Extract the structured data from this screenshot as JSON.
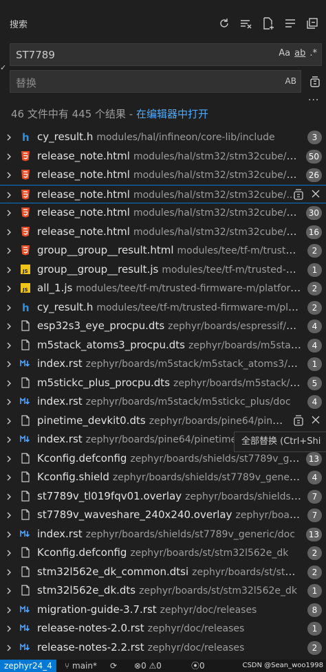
{
  "header": {
    "title": "搜索",
    "icons": [
      "refresh-icon",
      "clear-results-icon",
      "new-search-editor-icon",
      "view-as-tree-icon",
      "collapse-all-icon"
    ]
  },
  "search": {
    "value": "ST7789",
    "options": [
      "Aa",
      "ab",
      ".*"
    ]
  },
  "replace": {
    "placeholder": "替换",
    "preserve_case": "AB"
  },
  "summary": {
    "text": "46 文件中有 445 个结果 - ",
    "link": "在编辑器中打开"
  },
  "tooltip": "全部替换 (Ctrl+Shi",
  "results": [
    {
      "name": "cy_result.h",
      "path": "modules/hal/infineon/core-lib/include",
      "count": "3",
      "icon": "h"
    },
    {
      "name": "release_note.html",
      "path": "modules/hal/stm32/stm32cube/stm3...",
      "count": "50",
      "icon": "html"
    },
    {
      "name": "release_note.html",
      "path": "modules/hal/stm32/stm32cube/stm3...",
      "count": "26",
      "icon": "html"
    },
    {
      "name": "release_note.html",
      "path": "modules/hal/stm32/stm32cube/...",
      "count": "",
      "icon": "html",
      "selected": true
    },
    {
      "name": "release_note.html",
      "path": "modules/hal/stm32/stm32cube/stm3...",
      "count": "30",
      "icon": "html"
    },
    {
      "name": "release_note.html",
      "path": "modules/hal/stm32/stm32cube/stm3...",
      "count": "16",
      "icon": "html"
    },
    {
      "name": "group__group__result.html",
      "path": "modules/tee/tf-m/trusted-fi...",
      "count": "2",
      "icon": "html"
    },
    {
      "name": "group__group__result.js",
      "path": "modules/tee/tf-m/trusted-firm...",
      "count": "1",
      "icon": "js"
    },
    {
      "name": "all_1.js",
      "path": "modules/tee/tf-m/trusted-firmware-m/platform/e...",
      "count": "2",
      "icon": "js"
    },
    {
      "name": "cy_result.h",
      "path": "modules/tee/tf-m/trusted-firmware-m/platfor...",
      "count": "2",
      "icon": "h"
    },
    {
      "name": "esp32s3_eye_procpu.dts",
      "path": "zephyr/boards/espressif/esp32...",
      "count": "4",
      "icon": "file"
    },
    {
      "name": "m5stack_atoms3_procpu.dts",
      "path": "zephyr/boards/m5stack/m...",
      "count": "4",
      "icon": "file"
    },
    {
      "name": "index.rst",
      "path": "zephyr/boards/m5stack/m5stack_atoms3/doc",
      "count": "1",
      "icon": "md"
    },
    {
      "name": "m5stickc_plus_procpu.dts",
      "path": "zephyr/boards/m5stack/m5st...",
      "count": "5",
      "icon": "file"
    },
    {
      "name": "index.rst",
      "path": "zephyr/boards/m5stack/m5stickc_plus/doc",
      "count": "4",
      "icon": "md"
    },
    {
      "name": "pinetime_devkit0.dts",
      "path": "zephyr/boards/pine64/pineti...",
      "count": "",
      "icon": "file",
      "hovered": true
    },
    {
      "name": "index.rst",
      "path": "zephyr/boards/pine64/pinetime_d",
      "count": "",
      "icon": "md"
    },
    {
      "name": "Kconfig.defconfig",
      "path": "zephyr/boards/shields/st7789v_generic",
      "count": "13",
      "icon": "file"
    },
    {
      "name": "Kconfig.shield",
      "path": "zephyr/boards/shields/st7789v_generic",
      "count": "4",
      "icon": "file"
    },
    {
      "name": "st7789v_tl019fqv01.overlay",
      "path": "zephyr/boards/shields/st77...",
      "count": "7",
      "icon": "file"
    },
    {
      "name": "st7789v_waveshare_240x240.overlay",
      "path": "zephyr/boards/sh...",
      "count": "7",
      "icon": "file"
    },
    {
      "name": "index.rst",
      "path": "zephyr/boards/shields/st7789v_generic/doc",
      "count": "13",
      "icon": "md"
    },
    {
      "name": "Kconfig.defconfig",
      "path": "zephyr/boards/st/stm32l562e_dk",
      "count": "2",
      "icon": "file"
    },
    {
      "name": "stm32l562e_dk_common.dtsi",
      "path": "zephyr/boards/st/stm32l...",
      "count": "2",
      "icon": "file"
    },
    {
      "name": "stm32l562e_dk.dts",
      "path": "zephyr/boards/st/stm32l562e_dk",
      "count": "1",
      "icon": "file"
    },
    {
      "name": "migration-guide-3.7.rst",
      "path": "zephyr/doc/releases",
      "count": "8",
      "icon": "md"
    },
    {
      "name": "release-notes-2.0.rst",
      "path": "zephyr/doc/releases",
      "count": "1",
      "icon": "md"
    },
    {
      "name": "release-notes-2.2.rst",
      "path": "zephyr/doc/releases",
      "count": "2",
      "icon": "md"
    }
  ],
  "statusbar": {
    "remote": "zephyr24_4",
    "branch": "main*",
    "errors": "0",
    "warnings": "0",
    "ports": "0"
  },
  "watermark": "CSDN @Sean_woo1998"
}
